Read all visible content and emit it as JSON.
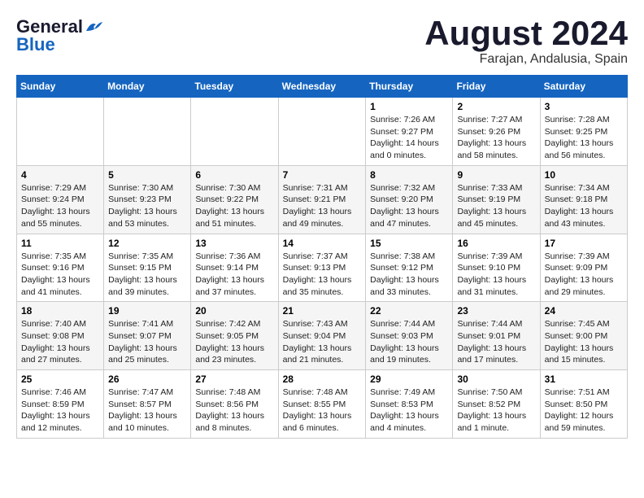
{
  "logo": {
    "line1": "General",
    "line2": "Blue"
  },
  "title": "August 2024",
  "location": "Farajan, Andalusia, Spain",
  "weekdays": [
    "Sunday",
    "Monday",
    "Tuesday",
    "Wednesday",
    "Thursday",
    "Friday",
    "Saturday"
  ],
  "weeks": [
    [
      {
        "day": "",
        "info": ""
      },
      {
        "day": "",
        "info": ""
      },
      {
        "day": "",
        "info": ""
      },
      {
        "day": "",
        "info": ""
      },
      {
        "day": "1",
        "info": "Sunrise: 7:26 AM\nSunset: 9:27 PM\nDaylight: 14 hours and 0 minutes."
      },
      {
        "day": "2",
        "info": "Sunrise: 7:27 AM\nSunset: 9:26 PM\nDaylight: 13 hours and 58 minutes."
      },
      {
        "day": "3",
        "info": "Sunrise: 7:28 AM\nSunset: 9:25 PM\nDaylight: 13 hours and 56 minutes."
      }
    ],
    [
      {
        "day": "4",
        "info": "Sunrise: 7:29 AM\nSunset: 9:24 PM\nDaylight: 13 hours and 55 minutes."
      },
      {
        "day": "5",
        "info": "Sunrise: 7:30 AM\nSunset: 9:23 PM\nDaylight: 13 hours and 53 minutes."
      },
      {
        "day": "6",
        "info": "Sunrise: 7:30 AM\nSunset: 9:22 PM\nDaylight: 13 hours and 51 minutes."
      },
      {
        "day": "7",
        "info": "Sunrise: 7:31 AM\nSunset: 9:21 PM\nDaylight: 13 hours and 49 minutes."
      },
      {
        "day": "8",
        "info": "Sunrise: 7:32 AM\nSunset: 9:20 PM\nDaylight: 13 hours and 47 minutes."
      },
      {
        "day": "9",
        "info": "Sunrise: 7:33 AM\nSunset: 9:19 PM\nDaylight: 13 hours and 45 minutes."
      },
      {
        "day": "10",
        "info": "Sunrise: 7:34 AM\nSunset: 9:18 PM\nDaylight: 13 hours and 43 minutes."
      }
    ],
    [
      {
        "day": "11",
        "info": "Sunrise: 7:35 AM\nSunset: 9:16 PM\nDaylight: 13 hours and 41 minutes."
      },
      {
        "day": "12",
        "info": "Sunrise: 7:35 AM\nSunset: 9:15 PM\nDaylight: 13 hours and 39 minutes."
      },
      {
        "day": "13",
        "info": "Sunrise: 7:36 AM\nSunset: 9:14 PM\nDaylight: 13 hours and 37 minutes."
      },
      {
        "day": "14",
        "info": "Sunrise: 7:37 AM\nSunset: 9:13 PM\nDaylight: 13 hours and 35 minutes."
      },
      {
        "day": "15",
        "info": "Sunrise: 7:38 AM\nSunset: 9:12 PM\nDaylight: 13 hours and 33 minutes."
      },
      {
        "day": "16",
        "info": "Sunrise: 7:39 AM\nSunset: 9:10 PM\nDaylight: 13 hours and 31 minutes."
      },
      {
        "day": "17",
        "info": "Sunrise: 7:39 AM\nSunset: 9:09 PM\nDaylight: 13 hours and 29 minutes."
      }
    ],
    [
      {
        "day": "18",
        "info": "Sunrise: 7:40 AM\nSunset: 9:08 PM\nDaylight: 13 hours and 27 minutes."
      },
      {
        "day": "19",
        "info": "Sunrise: 7:41 AM\nSunset: 9:07 PM\nDaylight: 13 hours and 25 minutes."
      },
      {
        "day": "20",
        "info": "Sunrise: 7:42 AM\nSunset: 9:05 PM\nDaylight: 13 hours and 23 minutes."
      },
      {
        "day": "21",
        "info": "Sunrise: 7:43 AM\nSunset: 9:04 PM\nDaylight: 13 hours and 21 minutes."
      },
      {
        "day": "22",
        "info": "Sunrise: 7:44 AM\nSunset: 9:03 PM\nDaylight: 13 hours and 19 minutes."
      },
      {
        "day": "23",
        "info": "Sunrise: 7:44 AM\nSunset: 9:01 PM\nDaylight: 13 hours and 17 minutes."
      },
      {
        "day": "24",
        "info": "Sunrise: 7:45 AM\nSunset: 9:00 PM\nDaylight: 13 hours and 15 minutes."
      }
    ],
    [
      {
        "day": "25",
        "info": "Sunrise: 7:46 AM\nSunset: 8:59 PM\nDaylight: 13 hours and 12 minutes."
      },
      {
        "day": "26",
        "info": "Sunrise: 7:47 AM\nSunset: 8:57 PM\nDaylight: 13 hours and 10 minutes."
      },
      {
        "day": "27",
        "info": "Sunrise: 7:48 AM\nSunset: 8:56 PM\nDaylight: 13 hours and 8 minutes."
      },
      {
        "day": "28",
        "info": "Sunrise: 7:48 AM\nSunset: 8:55 PM\nDaylight: 13 hours and 6 minutes."
      },
      {
        "day": "29",
        "info": "Sunrise: 7:49 AM\nSunset: 8:53 PM\nDaylight: 13 hours and 4 minutes."
      },
      {
        "day": "30",
        "info": "Sunrise: 7:50 AM\nSunset: 8:52 PM\nDaylight: 13 hours and 1 minute."
      },
      {
        "day": "31",
        "info": "Sunrise: 7:51 AM\nSunset: 8:50 PM\nDaylight: 12 hours and 59 minutes."
      }
    ]
  ]
}
